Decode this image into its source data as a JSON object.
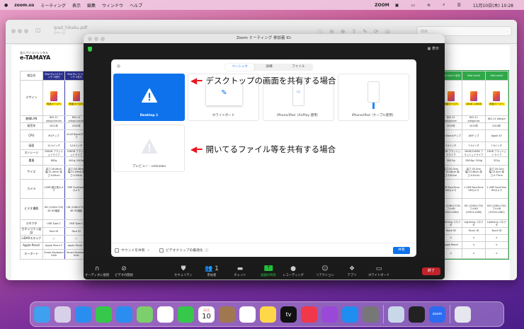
{
  "menubar": {
    "app": "zoom.us",
    "items": [
      "ミーティング",
      "表示",
      "編集",
      "ウィンドウ",
      "ヘルプ"
    ],
    "right_zoom": "ZOOM",
    "datetime": "11月10日(木) 10:28"
  },
  "preview": {
    "title": "ipad_hikaku.pdf",
    "subtitle": "1ページ",
    "search_placeholder": "検索",
    "brand_small": "法人パソコンレンタル",
    "brand": "e-TAMAYA",
    "left_table": {
      "rows": [
        [
          "商品名",
          "iPad Pro 12.9インチ 5世代",
          "iPad Pro 12.9インチ 4世代"
        ],
        [
          "デザイン",
          "商品ページへ",
          "商品ページへ"
        ],
        [
          "無線LAN",
          "802.11 a/b/g/n/ac/ax",
          "802.11 a/b/g/n/ac/ax"
        ],
        [
          "発売年",
          "2021年",
          "2020年"
        ],
        [
          "CPU",
          "M1チップ",
          "A12Z Bionicチップ"
        ],
        [
          "画面",
          "12.9インチ",
          "12.9インチ"
        ],
        [
          "ストレージ",
          "256GB フラッシュドライブ",
          "256GB フラッシュドライブ"
        ],
        [
          "重量",
          "682g",
          "641g / 643g"
        ],
        [
          "サイズ",
          "高さ:28.06cm 幅:21.49cm 厚さ:0.64cm",
          "高さ:28.06cm 幅:21.49cm 厚さ:0.59cm"
        ],
        [
          "カメラ",
          "12MP 超広角カメラ",
          "7MP TrueDepthカメラ"
        ],
        [
          "ビデオ撮影",
          "HD (1280×720) 4K HD撮影",
          "HD (1280×720) 4K HD撮影"
        ],
        [
          "コネクタ",
          "USB Type-C",
          "USB Type-C"
        ],
        [
          "セキュリティ認証",
          "Face ID",
          "Face ID"
        ],
        [
          "LiDARスキャナ",
          "○",
          "○"
        ],
        [
          "Apple Pencil",
          "Apple Pencil 2",
          "Apple Pencil 2"
        ],
        [
          "キーボード",
          "Smart Keyboard Folio",
          "Smart Keyboard Folio"
        ]
      ]
    },
    "right_table": {
      "rows": [
        [
          "iPad mini 5 世代",
          "iPad mini4",
          "iPad mini3"
        ],
        [
          "商品ページへ",
          "16GB 128GB",
          "商品ページへ"
        ],
        [
          "802.11 a/b/g/n/ac",
          "802.11 a/b/g/n/ac",
          "802.11 a/b/g/n"
        ],
        [
          "2019年",
          "2015年",
          "2014年"
        ],
        [
          "A12 Bionicチップ",
          "A8チップ",
          "Apple A7"
        ],
        [
          "7.9インチ",
          "7.9インチ",
          "7.9インチ"
        ],
        [
          "64GB フラッシュドライブ",
          "16GB/128GB フラッシュドライブ",
          "16GB フラッシュドライブ"
        ],
        [
          "300.5g",
          "298.8g / 304g",
          "331g"
        ],
        [
          "高さ:20.3cm 幅:13.48cm 厚さ:0.61cm",
          "高さ:20.3cm 幅:13.48cm 厚さ:0.61cm",
          "高さ:20.0cm 幅:13.4cm 厚さ:0.75cm"
        ],
        [
          "7MP FaceTime HDカメラ",
          "1.2MP FaceTime HDカメラ",
          "1.2MP FaceTime HDカメラ"
        ],
        [
          "HD (1280×720) フルHD (1920×1080)",
          "HD (1280×720) フルHD (1920×1080)",
          "HD (1280×720) フルHD (1920×1080)"
        ],
        [
          "Lightning コネクタ",
          "Lightning コネクタ",
          "Lightning コネクタ"
        ],
        [
          "Touch ID",
          "Touch ID",
          "Touch ID"
        ],
        [
          "×",
          "×",
          "×"
        ],
        [
          "Apple Pencil",
          "×",
          "×"
        ],
        [
          "×",
          "×",
          "×"
        ]
      ]
    }
  },
  "zoom": {
    "title": "Zoom ミーティング 参加者 ID:",
    "view_label": "表示",
    "dialog": {
      "tabs": [
        "ベーシック",
        "詳細",
        "ファイル"
      ],
      "tiles": [
        "Desktop 1",
        "ホワイトボード",
        "iPhone/iPad（AirPlay 使用）",
        "iPhone/iPad（ケーブル使用）",
        "プレビュー - unknown"
      ],
      "annotation1": "デスクトップの画面を共有する場合",
      "annotation2": "開いてるファイル等を共有する場合",
      "share_sound": "サウンドを共有",
      "optimize_video": "ビデオクリップの最適化",
      "share_button": "共有"
    },
    "toolbar": [
      {
        "label": "オーディオに接続",
        "icon": "headphones-icon"
      },
      {
        "label": "ビデオの開始",
        "icon": "video-off-icon"
      },
      {
        "label": "セキュリティ",
        "icon": "shield-icon"
      },
      {
        "label": "参加者",
        "icon": "participants-icon",
        "count": "1"
      },
      {
        "label": "チャット",
        "icon": "chat-icon"
      },
      {
        "label": "画面の共有",
        "icon": "share-screen-icon"
      },
      {
        "label": "レコーディング",
        "icon": "record-icon"
      },
      {
        "label": "リアクション",
        "icon": "reaction-icon"
      },
      {
        "label": "アプリ",
        "icon": "apps-icon"
      },
      {
        "label": "ホワイトボード",
        "icon": "whiteboard-icon"
      }
    ],
    "end_button": "終了"
  },
  "dock": {
    "apps": [
      "Finder",
      "Launchpad",
      "Safari",
      "メッセージ",
      "メール",
      "マップ",
      "写真",
      "FaceTime",
      "カレンダー",
      "連絡先",
      "リマインダー",
      "メモ",
      "TV",
      "ミュージック",
      "Podcast",
      "App Store",
      "システム環境設定",
      "プレビュー",
      "QuickTime Player",
      "zoom.us",
      "ゴミ箱"
    ],
    "calendar_month": "11月",
    "calendar_day": "10",
    "tv_label": "tv",
    "zoom_label": "zoom"
  }
}
